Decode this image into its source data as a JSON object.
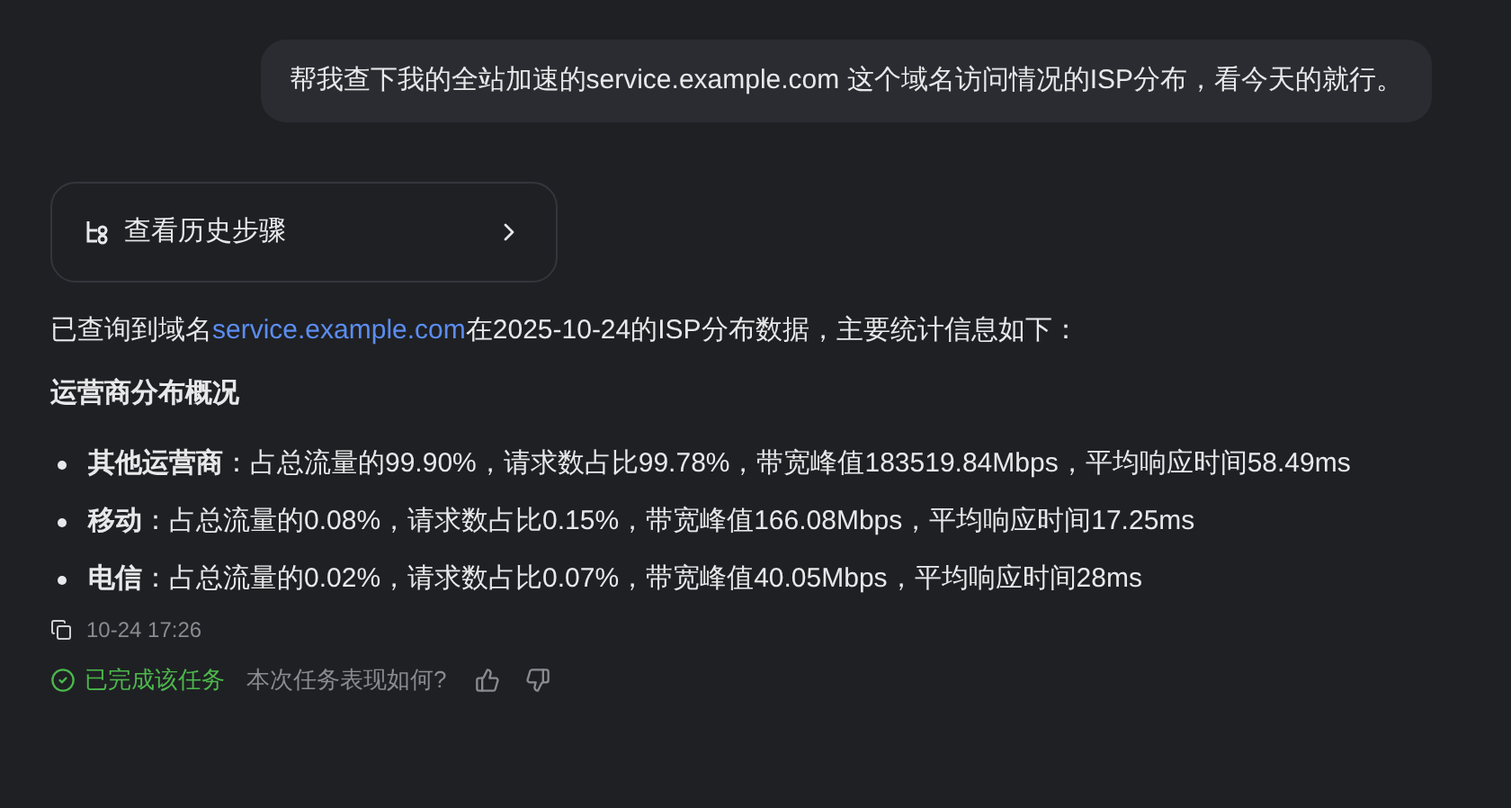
{
  "user_message": "帮我查下我的全站加速的service.example.com 这个域名访问情况的ISP分布，看今天的就行。",
  "history_button": {
    "label": "查看历史步骤"
  },
  "intro": {
    "before": "已查询到域名",
    "link": "service.example.com",
    "after": "在2025-10-24的ISP分布数据，主要统计信息如下："
  },
  "heading": "运营商分布概况",
  "bullets": [
    "**其他运营商**：占总流量的99.90%，请求数占比99.78%，带宽峰值183519.84Mbps，平均响应时间58.49ms",
    "**移动**：占总流量的0.08%，请求数占比0.15%，带宽峰值166.08Mbps，平均响应时间17.25ms",
    "**电信**：占总流量的0.02%，请求数占比0.07%，带宽峰值40.05Mbps，平均响应时间28ms"
  ],
  "timestamp": "10-24 17:26",
  "status": "已完成该任务",
  "feedback_prompt": "本次任务表现如何?"
}
